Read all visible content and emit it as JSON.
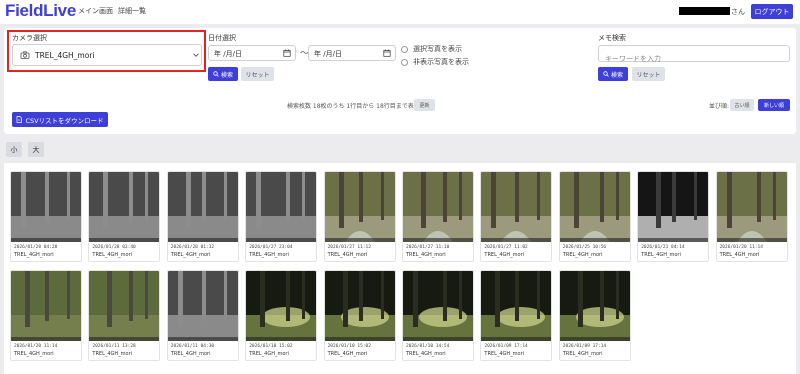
{
  "header": {
    "logo": "FieldLive",
    "nav": [
      "メイン画面",
      "詳細一覧"
    ],
    "user_suffix": "さん",
    "logout_label": "ログアウト"
  },
  "filters": {
    "camera": {
      "label": "カメラ選択",
      "selected": "TREL_4GH_mori"
    },
    "date": {
      "label": "日付選択",
      "from_placeholder": "年 /月/日",
      "to_placeholder": "年 /月/日",
      "separator": "〜",
      "show_selected": "選択写真を表示",
      "show_hidden": "非表示写真を表示",
      "search": "検索",
      "reset": "リセット"
    },
    "memo": {
      "label": "メモ検索",
      "placeholder": "キーワードを入力",
      "search": "検索",
      "reset": "リセット"
    }
  },
  "results": {
    "summary": "検索枚数 18枚のうち 1行目から 18行目まで表示",
    "refresh": "更新",
    "sort_label": "並び順:",
    "sort_old": "古い順",
    "sort_new": "新しい順"
  },
  "csv_label": "CSVリストをダウンロード",
  "size": {
    "small": "小",
    "large": "大"
  },
  "photos": [
    {
      "date": "2026/01/28 04:28",
      "camera": "TREL_4GH_mori",
      "scene": "night"
    },
    {
      "date": "2026/01/28 03:40",
      "camera": "TREL_4GH_mori",
      "scene": "night"
    },
    {
      "date": "2026/01/28 01:32",
      "camera": "TREL_4GH_mori",
      "scene": "night"
    },
    {
      "date": "2026/01/27 23:04",
      "camera": "TREL_4GH_mori",
      "scene": "night"
    },
    {
      "date": "2026/01/27 11:12",
      "camera": "TREL_4GH_mori",
      "scene": "day"
    },
    {
      "date": "2026/01/27 11:10",
      "camera": "TREL_4GH_mori",
      "scene": "day"
    },
    {
      "date": "2026/01/27 11:02",
      "camera": "TREL_4GH_mori",
      "scene": "day"
    },
    {
      "date": "2026/01/25 10:56",
      "camera": "TREL_4GH_mori",
      "scene": "day"
    },
    {
      "date": "2026/01/21 04:14",
      "camera": "TREL_4GH_mori",
      "scene": "night-dark"
    },
    {
      "date": "2026/01/20 11:14",
      "camera": "TREL_4GH_mori",
      "scene": "day"
    },
    {
      "date": "2026/01/20 11:14",
      "camera": "TREL_4GH_mori",
      "scene": "day-green"
    },
    {
      "date": "2026/01/11 13:28",
      "camera": "TREL_4GH_mori",
      "scene": "day-green"
    },
    {
      "date": "2026/01/11 04:30",
      "camera": "TREL_4GH_mori",
      "scene": "night"
    },
    {
      "date": "2026/01/10 15:02",
      "camera": "TREL_4GH_mori",
      "scene": "sunlit"
    },
    {
      "date": "2026/01/10 15:02",
      "camera": "TREL_4GH_mori",
      "scene": "sunlit"
    },
    {
      "date": "2026/01/10 14:54",
      "camera": "TREL_4GH_mori",
      "scene": "sunlit"
    },
    {
      "date": "2026/01/09 17:14",
      "camera": "TREL_4GH_mori",
      "scene": "sunlit"
    },
    {
      "date": "2026/01/09 17:14",
      "camera": "TREL_4GH_mori",
      "scene": "sunlit"
    }
  ],
  "colors": {
    "accent": "#3d3fd6",
    "highlight": "#e52420"
  }
}
